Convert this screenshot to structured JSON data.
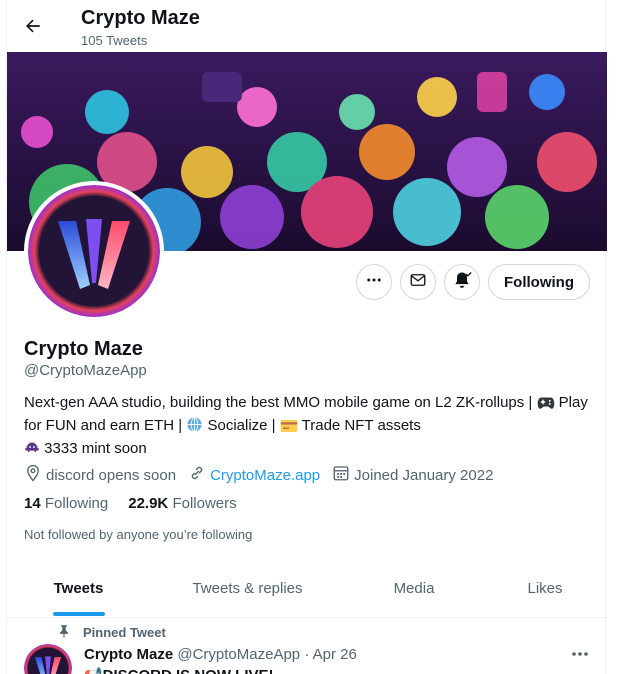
{
  "header": {
    "title": "Crypto Maze",
    "tweet_count": "105 Tweets"
  },
  "profile": {
    "name": "Crypto Maze",
    "handle": "@CryptoMazeApp",
    "bio_line1_prefix": "Next-gen AAA studio, building the best MMO mobile game on L2 ZK-rollups | ",
    "bio_play": "Play",
    "bio_line2": "for FUN and earn ETH | ",
    "bio_socialize": "Socialize | ",
    "bio_trade": "Trade NFT assets",
    "bio_line3": "3333 mint soon",
    "location": "discord opens soon",
    "website": "CryptoMaze.app",
    "joined": "Joined January 2022",
    "following_count": "14",
    "following_label": "Following",
    "followers_count": "22.9K",
    "followers_label": "Followers",
    "not_followed": "Not followed by anyone you’re following"
  },
  "actions": {
    "follow_label": "Following"
  },
  "tabs": [
    {
      "label": "Tweets"
    },
    {
      "label": "Tweets & replies"
    },
    {
      "label": "Media"
    },
    {
      "label": "Likes"
    }
  ],
  "pinned_tweet": {
    "pinned_label": "Pinned Tweet",
    "author": "Crypto Maze",
    "handle": "@CryptoMazeApp",
    "date": "· Apr 26",
    "text": "📢DISCORD IS NOW LIVE!"
  },
  "colors": {
    "accent": "#1d9bf0",
    "text": "#0f1419",
    "muted": "#536471",
    "banner_bg": "#2b1347"
  },
  "icons": [
    "back-arrow-icon",
    "more-icon",
    "mail-icon",
    "bell-icon",
    "location-icon",
    "link-icon",
    "calendar-icon",
    "pin-icon",
    "game-controller-icon",
    "globe-icon",
    "card-icon",
    "alien-icon"
  ]
}
